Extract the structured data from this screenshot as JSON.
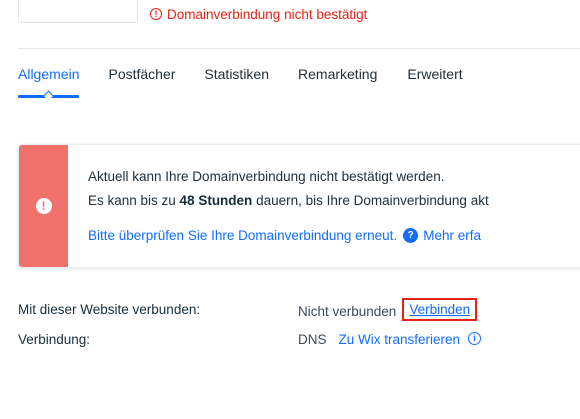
{
  "header": {
    "status_text": "Domainverbindung nicht bestätigt",
    "status_icon": "error-circle-icon",
    "status_color": "#e62214"
  },
  "tabs": [
    {
      "label": "Allgemein",
      "active": true
    },
    {
      "label": "Postfächer",
      "active": false
    },
    {
      "label": "Statistiken",
      "active": false
    },
    {
      "label": "Remarketing",
      "active": false
    },
    {
      "label": "Erweitert",
      "active": false
    }
  ],
  "alert": {
    "line1": "Aktuell kann Ihre Domainverbindung nicht bestätigt werden.",
    "line2_pre": "Es kann bis zu ",
    "line2_bold": "48 Stunden",
    "line2_post": " dauern, bis Ihre Domainverbindung akt",
    "recheck_link": "Bitte überprüfen Sie Ihre Domainverbindung erneut.",
    "more_link": "Mehr erfa",
    "accent_color": "#f1726c"
  },
  "details": {
    "connected_label": "Mit dieser Website verbunden:",
    "connected_value": "Nicht verbunden",
    "connect_button": "Verbinden",
    "connection_label": "Verbindung:",
    "connection_value": "DNS",
    "transfer_link": "Zu Wix transferieren"
  },
  "colors": {
    "link": "#116dff",
    "text": "#20303c"
  }
}
